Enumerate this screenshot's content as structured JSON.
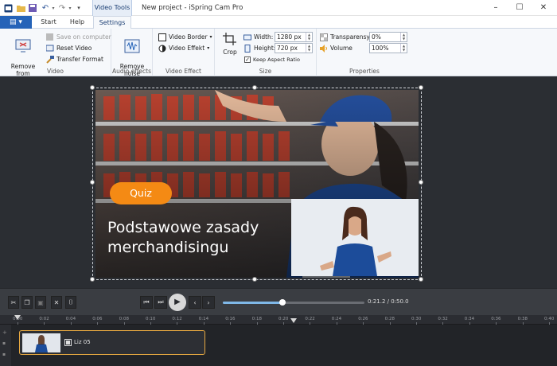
{
  "titlebar": {
    "context_tab": "Video Tools",
    "window_title": "New project - iSpring Cam Pro",
    "minimize": "–",
    "maximize": "☐",
    "close": "✕"
  },
  "tabs": {
    "file_icon": "▤ ▾",
    "items": [
      "Start",
      "Help",
      "Settings"
    ]
  },
  "ribbon": {
    "video": {
      "label": "Video",
      "remove_from_computer": "Remove from\ncomputer",
      "save_on_computer": "Save on computer",
      "reset_video": "Reset Video",
      "transfer_format": "Transfer Format"
    },
    "audio_effects": {
      "label": "Audio effects",
      "remove_noise": "Remove\nnoise"
    },
    "video_effect": {
      "label": "Video Effect",
      "video_border": "Video Border",
      "video_effekt": "Video Effekt"
    },
    "size": {
      "label": "Size",
      "crop": "Crop",
      "width_label": "Width:",
      "width_value": "1280 px",
      "height_label": "Height:",
      "height_value": "720 px",
      "keep_aspect": "Keep Aspect Ratio"
    },
    "properties": {
      "label": "Properties",
      "transparency_label": "Transparensy:",
      "transparency_value": "0%",
      "volume_label": "Volume",
      "volume_value": "100%"
    }
  },
  "slide": {
    "badge": "Quiz",
    "headline": "Podstawowe zasady merchandisingu"
  },
  "playback": {
    "time": "0:21.2 / 0:50.0",
    "progress": 0.42
  },
  "timeline": {
    "ticks": [
      "0:00",
      "0:02",
      "0:04",
      "0:06",
      "0:08",
      "0:10",
      "0:12",
      "0:14",
      "0:16",
      "0:18",
      "0:20",
      "0:22",
      "0:24",
      "0:26",
      "0:28",
      "0:30",
      "0:32",
      "0:34",
      "0:36",
      "0:38",
      "0:40"
    ],
    "clip_label": "Liz 05"
  },
  "colors": {
    "accent": "#2563b8",
    "quiz_orange": "#f48a14",
    "clip_border": "#e7a941"
  }
}
